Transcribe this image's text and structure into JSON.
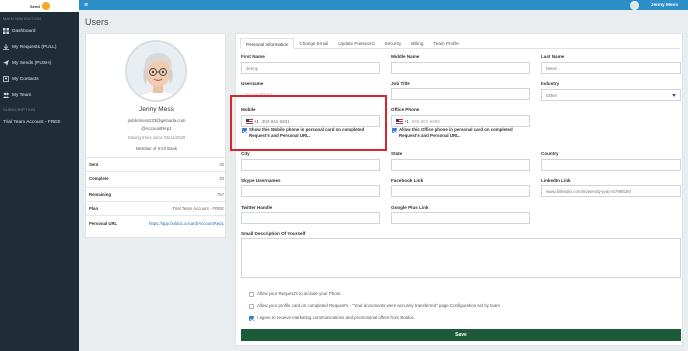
{
  "sidebar": {
    "logo_text": "Send",
    "section1": "Main Navigation",
    "items": [
      {
        "label": "Dashboard"
      },
      {
        "label": "My Requests (PULL)"
      },
      {
        "label": "My Sends (PUSH)"
      },
      {
        "label": "My Contacts"
      },
      {
        "label": "My Team"
      }
    ],
    "section2": "Subscription",
    "subscription": "Trial Team Account - FREE"
  },
  "topbar": {
    "menu_icon": "≡",
    "user_name": "Jenny Mess"
  },
  "page_title": "Users",
  "profile": {
    "name": "Jenny Mess",
    "email": "publicmess223@getnada.com",
    "handle": "@AccountRep1",
    "saving": "Saving trees since 05/11/2020",
    "member": "Member of XYZ Bank",
    "stats": [
      {
        "label": "Sent",
        "value": "32"
      },
      {
        "label": "Complete",
        "value": "40"
      },
      {
        "label": "Remaining",
        "value": "757"
      },
      {
        "label": "Plan",
        "value": "Trial Team Account - FREE"
      },
      {
        "label": "Personal URL",
        "value": "https://app.boldoc.io/card/AccountRep1"
      }
    ]
  },
  "tabs": [
    "Personal Information",
    "Change Email",
    "Update Password",
    "Security",
    "Billing",
    "Team Profile"
  ],
  "form": {
    "first_name_label": "First Name",
    "first_name": "Jenny",
    "middle_name_label": "Middle Name",
    "middle_name": "",
    "last_name_label": "Last Name",
    "last_name": "Mess",
    "username_label": "Username",
    "username": "AccountRep1",
    "job_title_label": "Job Title",
    "job_title": "",
    "industry_label": "Industry",
    "industry": "Other",
    "mobile_label": "Mobile",
    "mobile_cc": "+1",
    "mobile": "303-941-6921",
    "mobile_show": "Show this Mobile phone in personal card on completed Request's and Personal URL.",
    "office_label": "Office Phone",
    "office_cc": "+1",
    "office_placeholder": "888-800-8888",
    "office_show": "Allow this Office phone in personal card on completed Request's and Personal URL.",
    "city_label": "City",
    "state_label": "State",
    "country_label": "Country",
    "skype_label": "Skype Usernames",
    "facebook_label": "Facebook Link",
    "linkedin_label": "LinkedIn Link",
    "linkedin": "www.linkedin.com/in/wendy-jean-5795526/",
    "twitter_label": "Twitter Handle",
    "gplus_label": "Google Plus Link",
    "desc_label": "Small Description Of Yourself",
    "opt1": "Allow your Request's to include your Photo.",
    "opt2": "Allow your profile card on completed Request's - \"Your documents were securely transferred\" page.Configuration set by team",
    "opt3": "I agree to receive marketing communications and promotional offers from Boldoc.",
    "save": "Save"
  }
}
